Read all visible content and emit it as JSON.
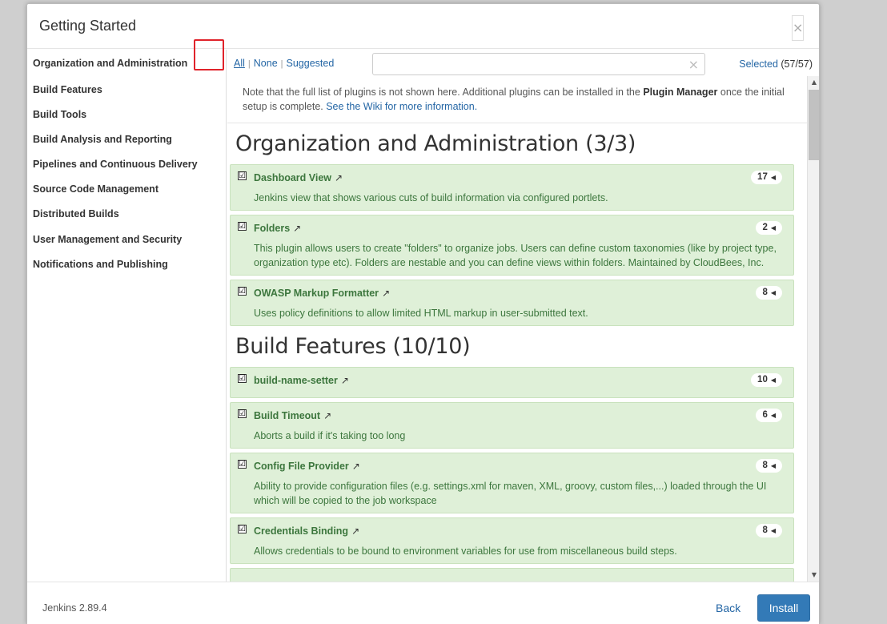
{
  "dialog": {
    "title": "Getting Started",
    "close_glyph": "×"
  },
  "sidebar": {
    "items": [
      {
        "label": "Organization and Administration"
      },
      {
        "label": "Build Features"
      },
      {
        "label": "Build Tools"
      },
      {
        "label": "Build Analysis and Reporting"
      },
      {
        "label": "Pipelines and Continuous Delivery"
      },
      {
        "label": "Source Code Management"
      },
      {
        "label": "Distributed Builds"
      },
      {
        "label": "User Management and Security"
      },
      {
        "label": "Notifications and Publishing"
      }
    ]
  },
  "toolbar": {
    "filter_all": "All",
    "filter_none": "None",
    "filter_suggested": "Suggested",
    "separator": "|",
    "search_placeholder": "",
    "search_value": "",
    "selected_label": "Selected",
    "selected_count": "(57/57)"
  },
  "note": {
    "text_before": "Note that the full list of plugins is not shown here. Additional plugins can be installed in the ",
    "bold": "Plugin Manager",
    "text_after": " once the initial setup is complete. ",
    "link": "See the Wiki for more information."
  },
  "categories": [
    {
      "title": "Organization and Administration (3/3)",
      "plugins": [
        {
          "name": "Dashboard View",
          "deps": "17",
          "desc": "Jenkins view that shows various cuts of build information via configured portlets."
        },
        {
          "name": "Folders",
          "deps": "2",
          "desc": "This plugin allows users to create \"folders\" to organize jobs. Users can define custom taxonomies (like by project type, organization type etc). Folders are nestable and you can define views within folders. Maintained by CloudBees, Inc."
        },
        {
          "name": "OWASP Markup Formatter",
          "deps": "8",
          "desc": "Uses policy definitions to allow limited HTML markup in user-submitted text."
        }
      ]
    },
    {
      "title": "Build Features (10/10)",
      "plugins": [
        {
          "name": "build-name-setter",
          "deps": "10",
          "desc": ""
        },
        {
          "name": "Build Timeout",
          "deps": "6",
          "desc": "Aborts a build if it's taking too long"
        },
        {
          "name": "Config File Provider",
          "deps": "8",
          "desc": "Ability to provide configuration files (e.g. settings.xml for maven, XML, groovy, custom files,...) loaded through the UI which will be copied to the job workspace"
        },
        {
          "name": "Credentials Binding",
          "deps": "8",
          "desc": "Allows credentials to be bound to environment variables for use from miscellaneous build steps."
        }
      ]
    }
  ],
  "icons": {
    "checkbox_glyph": "☑",
    "external_link_glyph": "↗",
    "caret_left_glyph": "◀",
    "clear_glyph": "×",
    "scroll_up_glyph": "▲",
    "scroll_down_glyph": "▼"
  },
  "footer": {
    "version": "Jenkins 2.89.4",
    "back_label": "Back",
    "install_label": "Install"
  },
  "colors": {
    "plugin_bg": "#dff0d8",
    "plugin_text": "#3c763d",
    "link": "#2466a5",
    "primary_button": "#337ab7",
    "highlight_box": "#e0232b"
  }
}
